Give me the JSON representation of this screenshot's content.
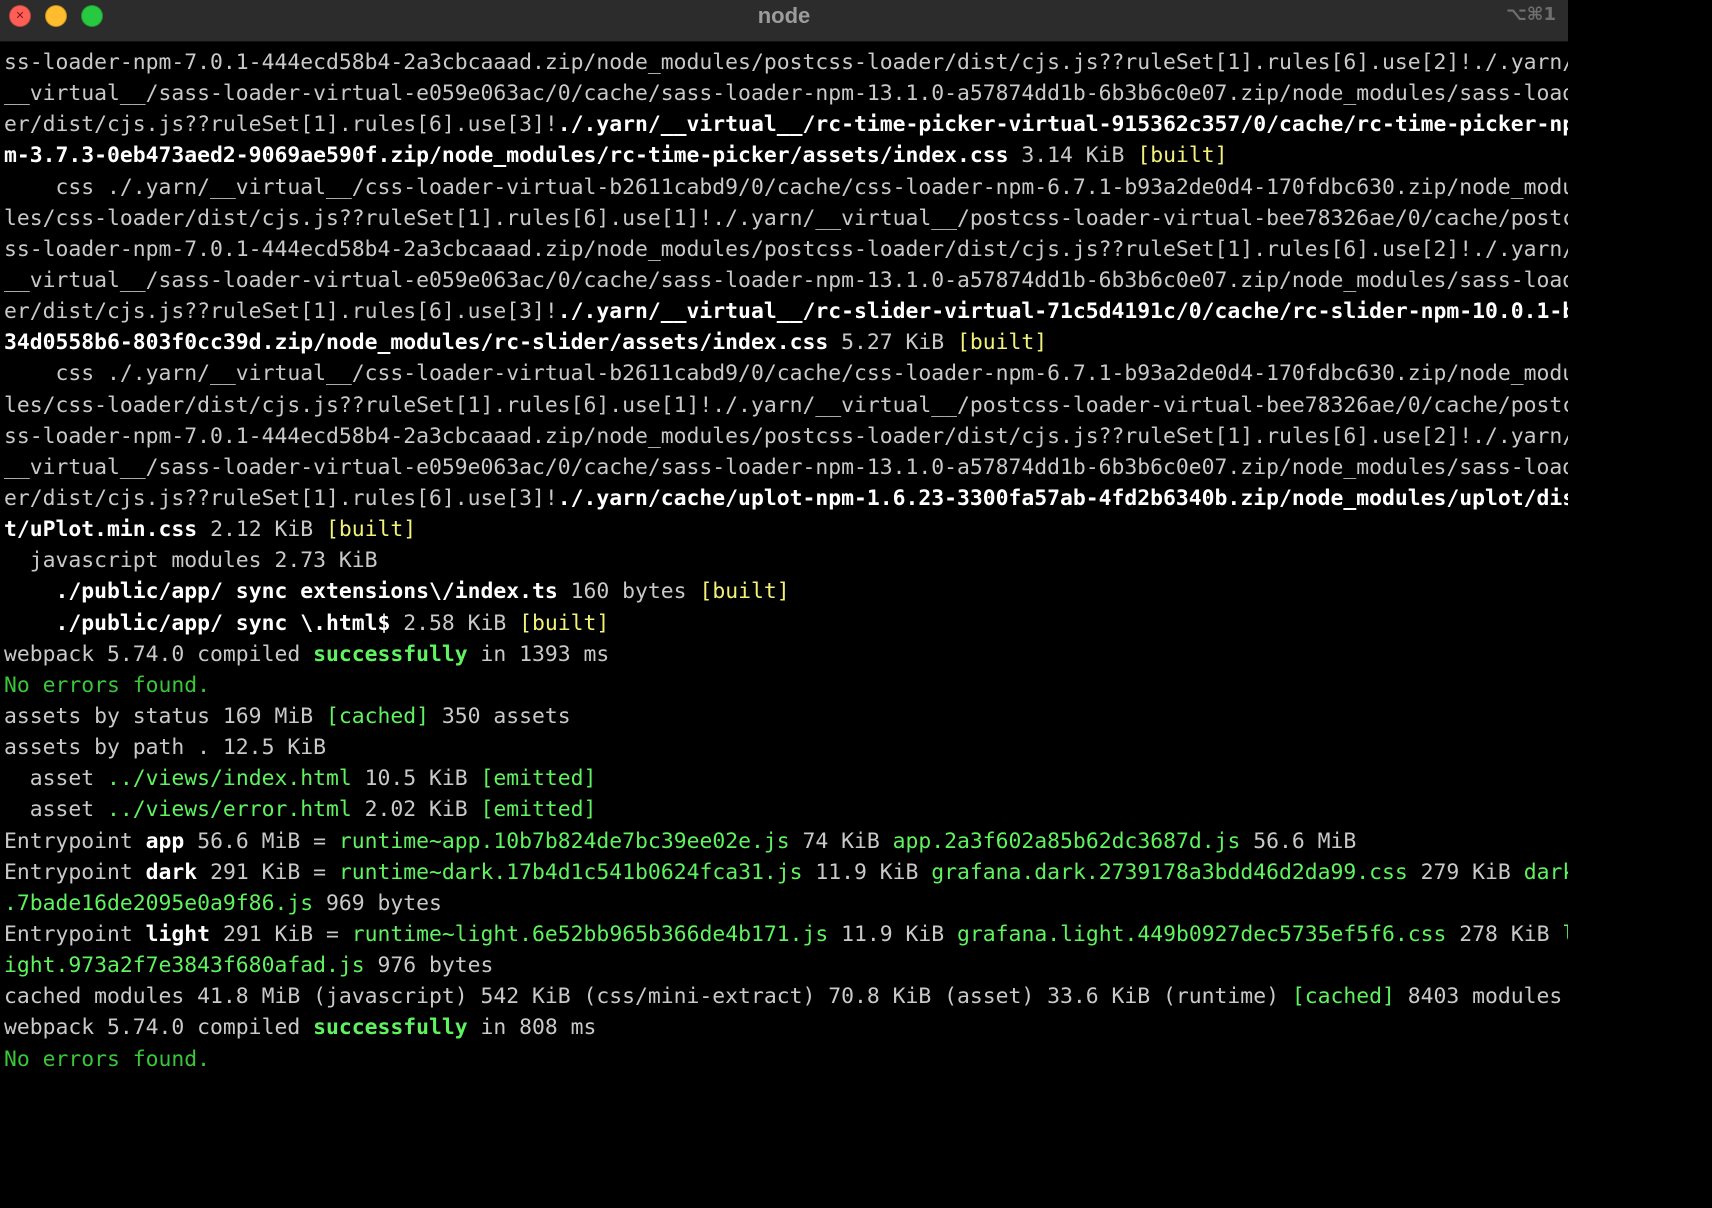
{
  "window": {
    "title": "node",
    "shortcut": "⌥⌘1",
    "colors": {
      "close": "#ff5f57",
      "minimize": "#febc2e",
      "maximize": "#28c840",
      "background": "#000000",
      "green": "#5ff35f",
      "yellow": "#f2f27a"
    }
  },
  "terminal": {
    "lines": [
      [
        {
          "t": "ss-loader-npm-7.0.1-444ecd58b4-2a3cbcaaad.zip/node_modules/postcss-loader/dist/cjs.js??ruleSet[1].rules[6].use[2]!./.yarn/",
          "s": "dim"
        }
      ],
      [
        {
          "t": "__virtual__/sass-loader-virtual-e059e063ac/0/cache/sass-loader-npm-13.1.0-a57874dd1b-6b3b6c0e07.zip/node_modules/sass-load",
          "s": "dim"
        }
      ],
      [
        {
          "t": "er/dist/cjs.js??ruleSet[1].rules[6].use[3]!",
          "s": "dim"
        },
        {
          "t": "./.yarn/__virtual__/rc-time-picker-virtual-915362c357/0/cache/rc-time-picker-np",
          "s": "bold"
        }
      ],
      [
        {
          "t": "m-3.7.3-0eb473aed2-9069ae590f.zip/node_modules/rc-time-picker/assets/index.css",
          "s": "bold"
        },
        {
          "t": " 3.14 KiB ",
          "s": "dim"
        },
        {
          "t": "[built]",
          "s": "yellow"
        }
      ],
      [
        {
          "t": "    css ./.yarn/__virtual__/css-loader-virtual-b2611cabd9/0/cache/css-loader-npm-6.7.1-b93a2de0d4-170fdbc630.zip/node_modu",
          "s": "dim"
        }
      ],
      [
        {
          "t": "les/css-loader/dist/cjs.js??ruleSet[1].rules[6].use[1]!./.yarn/__virtual__/postcss-loader-virtual-bee78326ae/0/cache/postc",
          "s": "dim"
        }
      ],
      [
        {
          "t": "ss-loader-npm-7.0.1-444ecd58b4-2a3cbcaaad.zip/node_modules/postcss-loader/dist/cjs.js??ruleSet[1].rules[6].use[2]!./.yarn/",
          "s": "dim"
        }
      ],
      [
        {
          "t": "__virtual__/sass-loader-virtual-e059e063ac/0/cache/sass-loader-npm-13.1.0-a57874dd1b-6b3b6c0e07.zip/node_modules/sass-load",
          "s": "dim"
        }
      ],
      [
        {
          "t": "er/dist/cjs.js??ruleSet[1].rules[6].use[3]!",
          "s": "dim"
        },
        {
          "t": "./.yarn/__virtual__/rc-slider-virtual-71c5d4191c/0/cache/rc-slider-npm-10.0.1-b",
          "s": "bold"
        }
      ],
      [
        {
          "t": "34d0558b6-803f0cc39d.zip/node_modules/rc-slider/assets/index.css",
          "s": "bold"
        },
        {
          "t": " 5.27 KiB ",
          "s": "dim"
        },
        {
          "t": "[built]",
          "s": "yellow"
        }
      ],
      [
        {
          "t": "    css ./.yarn/__virtual__/css-loader-virtual-b2611cabd9/0/cache/css-loader-npm-6.7.1-b93a2de0d4-170fdbc630.zip/node_modu",
          "s": "dim"
        }
      ],
      [
        {
          "t": "les/css-loader/dist/cjs.js??ruleSet[1].rules[6].use[1]!./.yarn/__virtual__/postcss-loader-virtual-bee78326ae/0/cache/postc",
          "s": "dim"
        }
      ],
      [
        {
          "t": "ss-loader-npm-7.0.1-444ecd58b4-2a3cbcaaad.zip/node_modules/postcss-loader/dist/cjs.js??ruleSet[1].rules[6].use[2]!./.yarn/",
          "s": "dim"
        }
      ],
      [
        {
          "t": "__virtual__/sass-loader-virtual-e059e063ac/0/cache/sass-loader-npm-13.1.0-a57874dd1b-6b3b6c0e07.zip/node_modules/sass-load",
          "s": "dim"
        }
      ],
      [
        {
          "t": "er/dist/cjs.js??ruleSet[1].rules[6].use[3]!",
          "s": "dim"
        },
        {
          "t": "./.yarn/cache/uplot-npm-1.6.23-3300fa57ab-4fd2b6340b.zip/node_modules/uplot/dis",
          "s": "bold"
        }
      ],
      [
        {
          "t": "t/uPlot.min.css",
          "s": "bold"
        },
        {
          "t": " 2.12 KiB ",
          "s": "dim"
        },
        {
          "t": "[built]",
          "s": "yellow"
        }
      ],
      [
        {
          "t": "  javascript modules 2.73 KiB",
          "s": "dim"
        }
      ],
      [
        {
          "t": "    ",
          "s": "dim"
        },
        {
          "t": "./public/app/ sync extensions\\/index.ts",
          "s": "bold"
        },
        {
          "t": " 160 bytes ",
          "s": "dim"
        },
        {
          "t": "[built]",
          "s": "yellow"
        }
      ],
      [
        {
          "t": "    ",
          "s": "dim"
        },
        {
          "t": "./public/app/ sync \\.html$",
          "s": "bold"
        },
        {
          "t": " 2.58 KiB ",
          "s": "dim"
        },
        {
          "t": "[built]",
          "s": "yellow"
        }
      ],
      [
        {
          "t": "webpack 5.74.0 compiled ",
          "s": "dim"
        },
        {
          "t": "successfully",
          "s": "green-bold"
        },
        {
          "t": " in 1393 ms",
          "s": "dim"
        }
      ],
      [
        {
          "t": "No errors found.",
          "s": "green-dim"
        }
      ],
      [
        {
          "t": "assets by status 169 MiB ",
          "s": "dim"
        },
        {
          "t": "[cached]",
          "s": "green"
        },
        {
          "t": " 350 assets",
          "s": "dim"
        }
      ],
      [
        {
          "t": "assets by path . 12.5 KiB",
          "s": "dim"
        }
      ],
      [
        {
          "t": "  asset ",
          "s": "dim"
        },
        {
          "t": "../views/index.html",
          "s": "green"
        },
        {
          "t": " 10.5 KiB ",
          "s": "dim"
        },
        {
          "t": "[emitted]",
          "s": "green"
        }
      ],
      [
        {
          "t": "  asset ",
          "s": "dim"
        },
        {
          "t": "../views/error.html",
          "s": "green"
        },
        {
          "t": " 2.02 KiB ",
          "s": "dim"
        },
        {
          "t": "[emitted]",
          "s": "green"
        }
      ],
      [
        {
          "t": "Entrypoint ",
          "s": "dim"
        },
        {
          "t": "app",
          "s": "bold"
        },
        {
          "t": " 56.6 MiB = ",
          "s": "dim"
        },
        {
          "t": "runtime~app.10b7b824de7bc39ee02e.js",
          "s": "green"
        },
        {
          "t": " 74 KiB ",
          "s": "dim"
        },
        {
          "t": "app.2a3f602a85b62dc3687d.js",
          "s": "green"
        },
        {
          "t": " 56.6 MiB",
          "s": "dim"
        }
      ],
      [
        {
          "t": "Entrypoint ",
          "s": "dim"
        },
        {
          "t": "dark",
          "s": "bold"
        },
        {
          "t": " 291 KiB = ",
          "s": "dim"
        },
        {
          "t": "runtime~dark.17b4d1c541b0624fca31.js",
          "s": "green"
        },
        {
          "t": " 11.9 KiB ",
          "s": "dim"
        },
        {
          "t": "grafana.dark.2739178a3bdd46d2da99.css",
          "s": "green"
        },
        {
          "t": " 279 KiB ",
          "s": "dim"
        },
        {
          "t": "dark",
          "s": "green"
        }
      ],
      [
        {
          "t": ".7bade16de2095e0a9f86.js",
          "s": "green"
        },
        {
          "t": " 969 bytes",
          "s": "dim"
        }
      ],
      [
        {
          "t": "Entrypoint ",
          "s": "dim"
        },
        {
          "t": "light",
          "s": "bold"
        },
        {
          "t": " 291 KiB = ",
          "s": "dim"
        },
        {
          "t": "runtime~light.6e52bb965b366de4b171.js",
          "s": "green"
        },
        {
          "t": " 11.9 KiB ",
          "s": "dim"
        },
        {
          "t": "grafana.light.449b0927dec5735ef5f6.css",
          "s": "green"
        },
        {
          "t": " 278 KiB ",
          "s": "dim"
        },
        {
          "t": "l",
          "s": "green"
        }
      ],
      [
        {
          "t": "ight.973a2f7e3843f680afad.js",
          "s": "green"
        },
        {
          "t": " 976 bytes",
          "s": "dim"
        }
      ],
      [
        {
          "t": "cached modules 41.8 MiB (javascript) 542 KiB (css/mini-extract) 70.8 KiB (asset) 33.6 KiB (runtime) ",
          "s": "dim"
        },
        {
          "t": "[cached]",
          "s": "green"
        },
        {
          "t": " 8403 modules",
          "s": "dim"
        }
      ],
      [
        {
          "t": "webpack 5.74.0 compiled ",
          "s": "dim"
        },
        {
          "t": "successfully",
          "s": "green-bold"
        },
        {
          "t": " in 808 ms",
          "s": "dim"
        }
      ],
      [
        {
          "t": "No errors found.",
          "s": "green-dim"
        }
      ]
    ]
  }
}
